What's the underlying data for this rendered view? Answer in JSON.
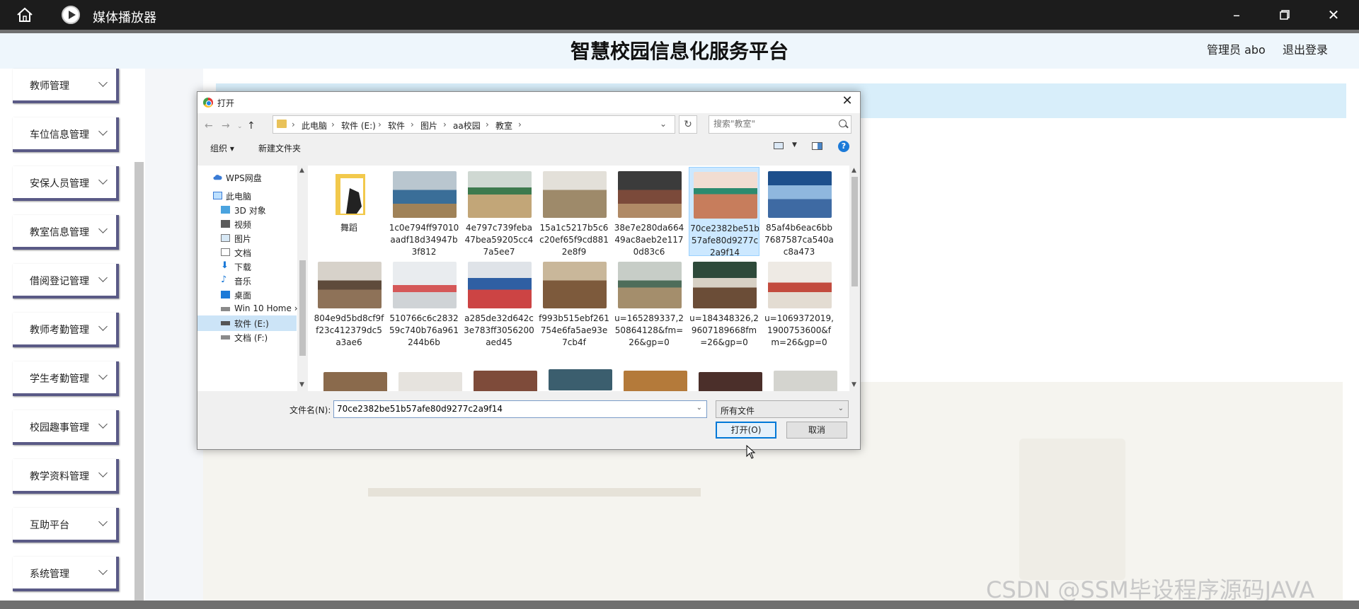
{
  "titlebar": {
    "title": "媒体播放器"
  },
  "header": {
    "page_title": "智慧校园信息化服务平台",
    "admin": "管理员 abo",
    "logout": "退出登录"
  },
  "sidebar": {
    "items": [
      {
        "label": "教师管理"
      },
      {
        "label": "车位信息管理"
      },
      {
        "label": "安保人员管理"
      },
      {
        "label": "教室信息管理"
      },
      {
        "label": "借阅登记管理"
      },
      {
        "label": "教师考勤管理"
      },
      {
        "label": "学生考勤管理"
      },
      {
        "label": "校园趣事管理"
      },
      {
        "label": "教学资料管理"
      },
      {
        "label": "互助平台"
      },
      {
        "label": "系统管理"
      }
    ]
  },
  "watermark": "CSDN @SSM毕设程序源码JAVA",
  "dialog": {
    "title": "打开",
    "breadcrumb": [
      "此电脑",
      "软件 (E:)",
      "软件",
      "图片",
      "aa校园",
      "教室"
    ],
    "search_placeholder": "搜索\"教室\"",
    "organize": "组织 ▾",
    "new_folder": "新建文件夹",
    "help": "?",
    "nav": [
      {
        "label": "WPS网盘",
        "icon": "cloud-icon"
      },
      {
        "label": "此电脑",
        "icon": "computer-icon"
      },
      {
        "label": "3D 对象",
        "icon": "cube-icon"
      },
      {
        "label": "视频",
        "icon": "video-icon"
      },
      {
        "label": "图片",
        "icon": "picture-icon"
      },
      {
        "label": "文档",
        "icon": "document-icon"
      },
      {
        "label": "下载",
        "icon": "download-icon"
      },
      {
        "label": "音乐",
        "icon": "music-icon"
      },
      {
        "label": "桌面",
        "icon": "desktop-icon"
      },
      {
        "label": "Win 10 Home ›",
        "icon": "drive-icon"
      },
      {
        "label": "软件 (E:)",
        "icon": "drive-icon",
        "selected": true
      },
      {
        "label": "文档 (F:)",
        "icon": "drive-icon"
      }
    ],
    "files": [
      {
        "name": "舞蹈",
        "folder": true
      },
      {
        "name": "1c0e794ff97010aadf18d34947b3f812"
      },
      {
        "name": "4e797c739feba47bea59205cc47a5ee7"
      },
      {
        "name": "15a1c5217b5c6c20ef65f9cd8812e8f9"
      },
      {
        "name": "38e7e280da66449ac8aeb2e1170d83c6"
      },
      {
        "name": "70ce2382be51b57afe80d9277c2a9f14",
        "selected": true
      },
      {
        "name": "85af4b6eac6bb7687587ca540ac8a473"
      },
      {
        "name": "804e9d5bd8cf9ff23c412379dc5a3ae6"
      },
      {
        "name": "510766c6c283259c740b76a961244b6b"
      },
      {
        "name": "a285de32d642c3e783ff3056200aed45"
      },
      {
        "name": "f993b515ebf261754e6fa5ae93e7cb4f"
      },
      {
        "name": "u=165289337,250864128&fm=26&gp=0"
      },
      {
        "name": "u=184348326,29607189668fm=26&gp=0"
      },
      {
        "name": "u=1069372019,1900753600&fm=26&gp=0"
      }
    ],
    "filename_label": "文件名(N):",
    "filename_value": "70ce2382be51b57afe80d9277c2a9f14",
    "filetype": "所有文件",
    "open_button": "打开(O)",
    "cancel_button": "取消"
  },
  "colors": {
    "sidebar_border": "#5a5a86",
    "info_bar": "#d8eefa",
    "selection": "#cce8ff",
    "accent": "#0078d7"
  }
}
